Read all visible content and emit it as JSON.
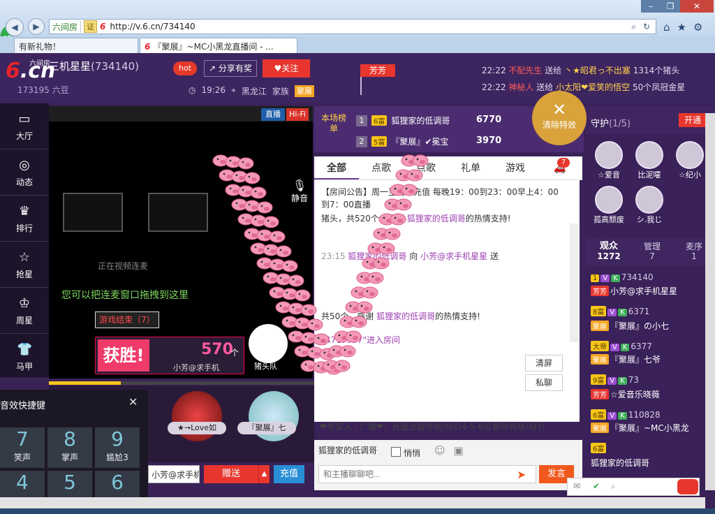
{
  "browser": {
    "site_name": "六间房",
    "cert": "证",
    "url": "http://v.6.cn/734140",
    "tabs": [
      {
        "label": "有新礼物！"
      },
      {
        "label": "『聚展』~MC小黑龙直播间 - ..."
      }
    ],
    "badge_count": "45"
  },
  "header": {
    "logo": "6.cn",
    "logo_sub": "六间房",
    "anchor_name": "三机星星",
    "room_id": "(734140)",
    "beans": "173195 六豆",
    "hot": "hot",
    "share": "分享有奖",
    "follow": "关注",
    "time": "19:26",
    "location": "黑龙江",
    "family_label": "家族",
    "family": "聚展",
    "flag": "芳芳"
  },
  "ticker": [
    {
      "time": "22:22",
      "user": "不配先生",
      "verb": "送给",
      "target": "丶★昭君っ不出塞",
      "gift": "1314个猪头"
    },
    {
      "time": "22:22",
      "user": "神秘人",
      "verb": "送给",
      "target": "小太阳❤爱笑的悟空",
      "gift": "50个凤冠金星"
    }
  ],
  "leftnav": [
    "大厅",
    "动态",
    "排行",
    "抢星",
    "周星",
    "马甲"
  ],
  "video": {
    "live": "直播",
    "hifi": "Hi-Fi",
    "connecting": "正在视频连麦",
    "drag_hint": "您可以把连麦窗口拖拽到这里",
    "mute": "静音",
    "game_over": "游戏结束（7）",
    "win_label": "获胜!",
    "score": "570",
    "score_unit": "个",
    "winner": "小芳@求手机",
    "team": "猪头队",
    "progress": 0.27
  },
  "gifts": [
    {
      "name": "★→Love如"
    },
    {
      "name": "『聚展』七"
    }
  ],
  "send": {
    "recipient": "小芳@求手机",
    "give": "赠送",
    "recharge": "充值"
  },
  "sfx": {
    "title": "音效快捷键",
    "keys": [
      {
        "n": "7",
        "label": "笑声"
      },
      {
        "n": "8",
        "label": "掌声"
      },
      {
        "n": "9",
        "label": "尴尬3"
      },
      {
        "n": "4",
        "label": ""
      },
      {
        "n": "5",
        "label": ""
      },
      {
        "n": "6",
        "label": ""
      }
    ]
  },
  "ranking": {
    "title": "本场榜单",
    "rows": [
      {
        "rank": "1",
        "level": "6富",
        "name": "狐狸家的低调哥",
        "value": "6770"
      },
      {
        "rank": "2",
        "level": "5富",
        "name": "『聚展』✔冕宝",
        "value": "3970"
      }
    ]
  },
  "clear_fx": {
    "label": "清除特效"
  },
  "fx_count": "7",
  "chat": {
    "tabs": [
      "全部",
      "点歌",
      "点歌",
      "礼单",
      "游戏"
    ],
    "notice": "【房间公告】周一至周五充值 每晚19：00到23：00早上4：00到7：00直播",
    "lines": [
      {
        "text": "猪头，共520个，感谢",
        "user": "狐狸家的低调哥",
        "tail": "的热情支持!"
      },
      {
        "time": "23:15",
        "user": "狐狸家的低调哥",
        "verb": "向",
        "target": "小芳@求手机星星",
        "action": "送"
      },
      {
        "text": "共50个，感谢",
        "user": "狐狸家的低调哥",
        "tail": "的热情支持!"
      },
      {
        "text": "_4717937\"进入房间"
      }
    ],
    "clear": "清屏",
    "pm": "私聊",
    "broadcast": "❤老实人☆广播❤：充值送靓号啦/勾引4-5-6位要啥有啥/勾引",
    "target": "狐狸家的低调哥",
    "whisper": "悄悄",
    "placeholder": "和主播聊聊吧...",
    "send": "发言"
  },
  "guard": {
    "title": "守护",
    "count": "(1/5)",
    "open": "开通",
    "members": [
      "☆爱音",
      "比泥嚯",
      "☆纪小",
      "孤高颓废",
      "シ.我じ"
    ]
  },
  "audience": {
    "tabs": [
      {
        "label": "观众",
        "count": "1272"
      },
      {
        "label": "管理",
        "count": "7"
      },
      {
        "label": "麦序",
        "count": "1"
      }
    ],
    "users": [
      {
        "lv": "1",
        "id": "734140",
        "fam": "芳芳",
        "name": "小芳@求手机星星"
      },
      {
        "lv": "8富",
        "id": "6371",
        "fam": "聚展",
        "name": "『聚展』の小七"
      },
      {
        "lv": "大帝",
        "id": "6377",
        "fam": "聚展",
        "name": "『聚展』七爷"
      },
      {
        "lv": "9富",
        "id": "73",
        "fam": "芳芳",
        "name": "☆爱音乐晓薇"
      },
      {
        "lv": "6富",
        "id": "110828",
        "fam": "聚展",
        "name": "『聚展』~MC小黑龙"
      },
      {
        "lv": "6富",
        "id": "",
        "fam": "",
        "name": "狐狸家的低调哥"
      }
    ]
  }
}
